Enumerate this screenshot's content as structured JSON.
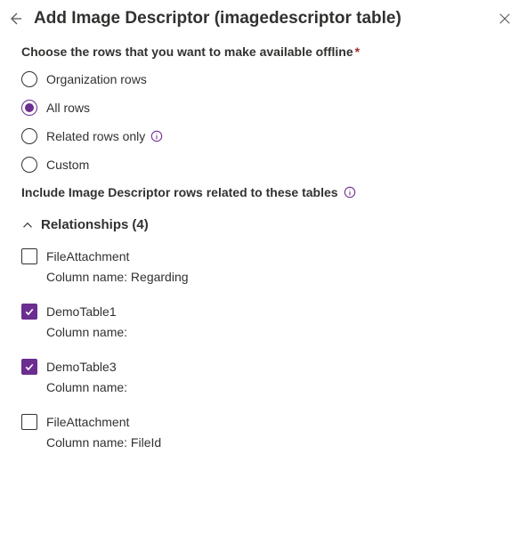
{
  "header": {
    "title": "Add Image Descriptor (imagedescriptor table)"
  },
  "prompt": "Choose the rows that you want to make available offline",
  "radios": [
    {
      "label": "Organization rows",
      "selected": false,
      "info": false
    },
    {
      "label": "All rows",
      "selected": true,
      "info": false
    },
    {
      "label": "Related rows only",
      "selected": false,
      "info": true
    },
    {
      "label": "Custom",
      "selected": false,
      "info": false
    }
  ],
  "subheading": "Include Image Descriptor rows related to these tables",
  "relationships": {
    "title_prefix": "Relationships",
    "count": "(4)",
    "items": [
      {
        "table": "FileAttachment",
        "column_label": "Column name: Regarding",
        "checked": false
      },
      {
        "table": "DemoTable1",
        "column_label": "Column name:",
        "checked": true
      },
      {
        "table": "DemoTable3",
        "column_label": "Column name:",
        "checked": true
      },
      {
        "table": "FileAttachment",
        "column_label": "Column name: FileId",
        "checked": false
      }
    ]
  }
}
